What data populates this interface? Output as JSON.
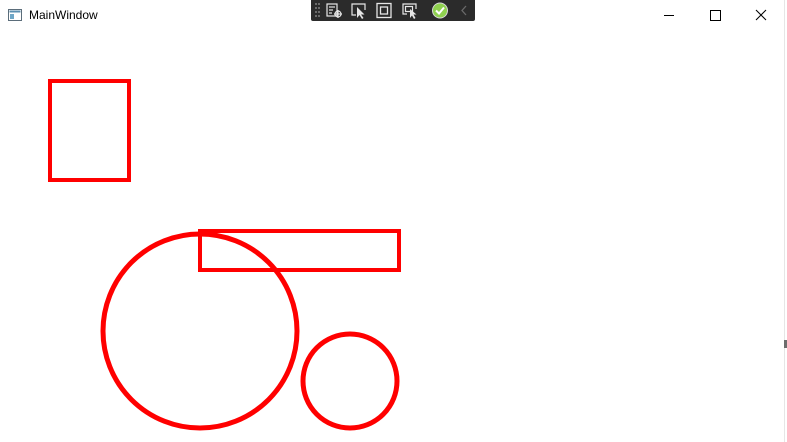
{
  "window": {
    "title": "MainWindow"
  },
  "titlebar": {
    "app_icon": "window-app-icon",
    "controls": [
      {
        "name": "minimize",
        "icon": "minimize-icon"
      },
      {
        "name": "maximize",
        "icon": "maximize-icon"
      },
      {
        "name": "close",
        "icon": "close-icon"
      }
    ]
  },
  "debug_toolbar": {
    "buttons": [
      {
        "name": "live-visual-tree",
        "icon": "visual-tree-icon"
      },
      {
        "name": "select-element",
        "icon": "select-element-icon"
      },
      {
        "name": "display-layout-adorners",
        "icon": "layout-adorner-icon"
      },
      {
        "name": "track-focused-element",
        "icon": "track-focus-icon"
      },
      {
        "name": "binding-failures",
        "icon": "check-circle-icon"
      },
      {
        "name": "collapse-toolbar",
        "icon": "chevron-left-icon"
      }
    ],
    "background": "#2b2b2b",
    "check_color": "#8fd14f"
  },
  "canvas": {
    "shapes": [
      {
        "kind": "rectangle",
        "name": "shape-rectangle-tall"
      },
      {
        "kind": "rectangle",
        "name": "shape-rectangle-wide"
      },
      {
        "kind": "ellipse",
        "name": "shape-circle-large"
      },
      {
        "kind": "ellipse",
        "name": "shape-circle-small"
      }
    ],
    "stroke_color": "#ff0000"
  }
}
